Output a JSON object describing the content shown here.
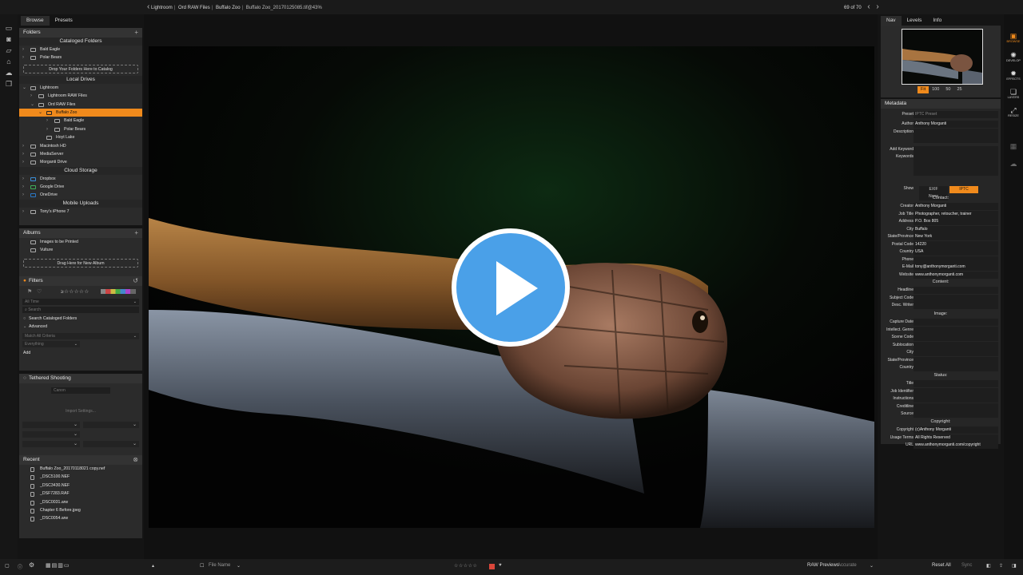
{
  "titlebar": {
    "breadcrumb": [
      "Lightroom",
      "Ord RAW Files",
      "Buffalo Zoo",
      "Buffalo Zoo_20170125085.tif@43%"
    ],
    "counter": "69 of 70"
  },
  "left_tabs": [
    "Browse",
    "Presets"
  ],
  "folders": {
    "title": "Folders",
    "cataloged_title": "Cataloged Folders",
    "cataloged": [
      "Bald Eagle",
      "Polar Bears"
    ],
    "drop_label": "Drop Your Folders Here to Catalog",
    "local_title": "Local Drives",
    "local": [
      {
        "label": "Lightroom",
        "depth": 0,
        "open": true
      },
      {
        "label": "Lightroom RAW Files",
        "depth": 1
      },
      {
        "label": "Ord RAW Files",
        "depth": 1,
        "open": true
      },
      {
        "label": "Buffalo Zoo",
        "depth": 2,
        "selected": true,
        "open": true
      },
      {
        "label": "Bald Eagle",
        "depth": 3
      },
      {
        "label": "Polar Bears",
        "depth": 3
      },
      {
        "label": "Hoyt Lake",
        "depth": 2
      },
      {
        "label": "Macintosh HD",
        "depth": 0
      },
      {
        "label": "MediaServer",
        "depth": 0
      },
      {
        "label": "Morganti Drive",
        "depth": 0
      }
    ],
    "cloud_title": "Cloud Storage",
    "cloud": [
      "Dropbox",
      "Google Drive",
      "OneDrive"
    ],
    "mobile_title": "Mobile Uploads",
    "mobile": [
      "Tony's iPhone 7"
    ]
  },
  "albums": {
    "title": "Albums",
    "items": [
      "Images to be Printed",
      "Vulture"
    ],
    "drop_label": "Drag Here for New Album"
  },
  "filters": {
    "title": "Filters",
    "time": "All Time",
    "search_placeholder": "Search",
    "search_cataloged": "Search Cataloged Folders",
    "advanced": "Advanced",
    "match": "Match All Criteria",
    "everything": "Everything",
    "add": "Add"
  },
  "tethered": {
    "title": "Tethered Shooting",
    "camera": "Canon",
    "import_settings": "Import Settings..."
  },
  "recent": {
    "title": "Recent",
    "items": [
      "Buffalo Zoo_20170118021 copy.nef",
      "_DSC5100.NEF",
      "_DSC3430.NEF",
      "_DSF7283.RAF",
      "_DSC0031.arw",
      "Chapter 6 Before.jpeg",
      "_DSC0054.arw"
    ]
  },
  "right_tabs": [
    "Nav",
    "Levels",
    "Info"
  ],
  "zoom": [
    "Fit",
    "100",
    "50",
    "25"
  ],
  "metadata": {
    "title": "Metadata",
    "preset_label": "Preset",
    "preset_value": "IPTC Preset",
    "author_label": "Author",
    "author_value": "Anthony Morganti",
    "description_label": "Description",
    "add_keyword_label": "Add Keyword",
    "keywords_label": "Keywords",
    "show_label": "Show",
    "show_options": [
      "EXIF",
      "IPTC",
      "None"
    ],
    "contact_title": "Contact:",
    "contact": [
      [
        "Creator",
        "Anthony Morganti"
      ],
      [
        "Job Title",
        "Photographer, retoucher, trainer"
      ],
      [
        "Address",
        "P.O. Box 805"
      ],
      [
        "City",
        "Buffalo"
      ],
      [
        "State/Province",
        "New York"
      ],
      [
        "Postal Code",
        "14220"
      ],
      [
        "Country",
        "USA"
      ],
      [
        "Phone",
        ""
      ],
      [
        "E-Mail",
        "tony@anthonymorganti.com"
      ],
      [
        "Website",
        "www.anthonymorganti.com"
      ]
    ],
    "content_title": "Content:",
    "content": [
      [
        "Headline",
        ""
      ],
      [
        "Subject Code",
        ""
      ],
      [
        "Desc. Writer",
        ""
      ]
    ],
    "image_title": "Image:",
    "image": [
      [
        "Capture Date",
        ""
      ],
      [
        "Intellect. Genre",
        ""
      ],
      [
        "Scene Code",
        ""
      ],
      [
        "Sublocation",
        ""
      ],
      [
        "City",
        ""
      ],
      [
        "State/Province",
        ""
      ],
      [
        "Country",
        ""
      ]
    ],
    "status_title": "Status:",
    "status": [
      [
        "Title",
        ""
      ],
      [
        "Job Identifier",
        ""
      ],
      [
        "Instructions",
        ""
      ],
      [
        "Creditline",
        ""
      ],
      [
        "Source",
        ""
      ]
    ],
    "copyright_title": "Copyright:",
    "copyright": [
      [
        "Copyright",
        "(c)Anthony Morganti"
      ],
      [
        "Usage Terms",
        "All Rights Reserved"
      ],
      [
        "URL",
        "www.anthonymorganti.com/copyright"
      ]
    ]
  },
  "modules": [
    "BROWSE",
    "DEVELOP",
    "EFFECTS",
    "LAYERS",
    "RESIZE"
  ],
  "bottombar": {
    "sort": "File Name",
    "raw_previews": "RAW Previews",
    "raw_mode": "Accurate",
    "reset_all": "Reset All",
    "sync": "Sync"
  },
  "colors": {
    "accent": "#f08a1c",
    "play": "#4aa0e8"
  }
}
